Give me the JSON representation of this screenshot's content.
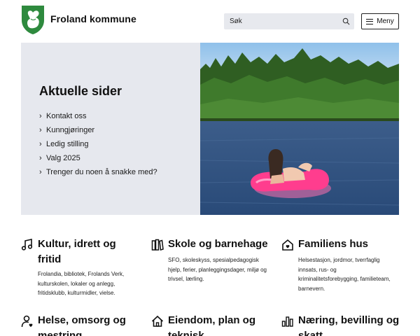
{
  "header": {
    "site_name": "Froland kommune",
    "logo_icon": "froland-coat-of-arms-icon",
    "search": {
      "placeholder": "Søk",
      "icon": "search-icon"
    },
    "menu_label": "Meny"
  },
  "hero": {
    "title": "Aktuelle sider",
    "links": [
      "Kontakt oss",
      "Kunngjøringer",
      "Ledig stilling",
      "Valg 2025",
      "Trenger du noen å snakke med?"
    ]
  },
  "categories": [
    {
      "icon": "music-note-icon",
      "title": "Kultur, idrett og fritid",
      "description": "Frolandia, bibliotek, Frolands Verk, kulturskolen, lokaler og anlegg, fritidsklubb, kulturmidler, vielse."
    },
    {
      "icon": "school-books-icon",
      "title": "Skole og barnehage",
      "description": "SFO, skoleskyss, spesialpedagogisk hjelp, ferier, planleggingsdager, miljø og trivsel, lærling."
    },
    {
      "icon": "family-house-icon",
      "title": "Familiens hus",
      "description": "Helsestasjon, jordmor, tverrfaglig innsats, rus- og kriminalitetsforebygging, familieteam, barnevern."
    },
    {
      "icon": "health-care-icon",
      "title": "Helse, omsorg og mestring",
      "description": ""
    },
    {
      "icon": "house-icon",
      "title": "Eiendom, plan og teknisk",
      "description": ""
    },
    {
      "icon": "bar-chart-icon",
      "title": "Næring, bevilling og skatt",
      "description": ""
    }
  ]
}
